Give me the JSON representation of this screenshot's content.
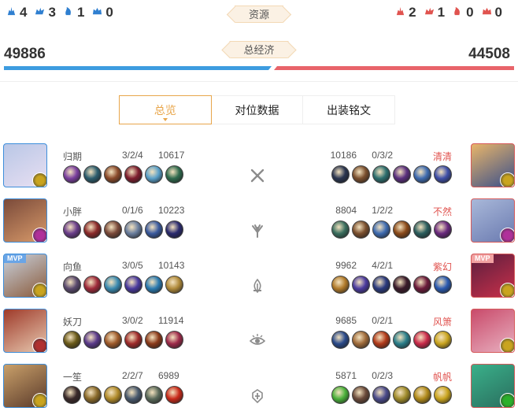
{
  "resources": {
    "label": "资源",
    "blue": [
      {
        "icon": "turret-icon",
        "value": "4"
      },
      {
        "icon": "dragon-icon",
        "value": "3"
      },
      {
        "icon": "tyrant-icon",
        "value": "1"
      },
      {
        "icon": "overlord-icon",
        "value": "0"
      }
    ],
    "red": [
      {
        "icon": "turret-icon",
        "value": "2"
      },
      {
        "icon": "dragon-icon",
        "value": "1"
      },
      {
        "icon": "tyrant-icon",
        "value": "0"
      },
      {
        "icon": "overlord-icon",
        "value": "0"
      }
    ],
    "colors": {
      "blue": "#2f7fd0",
      "red": "#e0534f"
    }
  },
  "economy": {
    "label": "总经济",
    "blue_total": "49886",
    "red_total": "44508",
    "blue_share": 0.528,
    "colors": {
      "blue": "#3d9ce0",
      "red": "#e8646a"
    }
  },
  "tabs": [
    {
      "label": "总览",
      "active": true
    },
    {
      "label": "对位数据",
      "active": false
    },
    {
      "label": "出装铭文",
      "active": false
    }
  ],
  "matchups": [
    {
      "objective_icon": "crossed-swords-icon",
      "blue": {
        "name": "归期",
        "kda": "3/2/4",
        "gold": "10617",
        "mvp": false,
        "portrait_colors": [
          "#b9c7e6",
          "#e8dff2"
        ],
        "spell_color": "#c9a41f",
        "items": [
          "#7a3f9e",
          "#2c5d6e",
          "#8a4a2a",
          "#7e1e2e",
          "#5aa0c9",
          "#2f6b4e"
        ]
      },
      "red": {
        "name": "清清",
        "kda": "0/3/2",
        "gold": "10186",
        "mvp": false,
        "portrait_colors": [
          "#e8b56a",
          "#3a4f8a"
        ],
        "spell_color": "#c9a41f",
        "items": [
          "#2a3550",
          "#7a4f2e",
          "#2c6e6e",
          "#5a2f7e",
          "#3e6bb0",
          "#3f4fa8"
        ]
      }
    },
    {
      "objective_icon": "jungle-icon",
      "blue": {
        "name": "小胖",
        "kda": "0/1/6",
        "gold": "10223",
        "mvp": false,
        "portrait_colors": [
          "#7a4a3a",
          "#d89a6a"
        ],
        "spell_color": "#b0309a",
        "items": [
          "#6a3e8a",
          "#8a2a2a",
          "#7a4a3a",
          "#6a7e9e",
          "#3a5a9e",
          "#2a2a6e"
        ]
      },
      "red": {
        "name": "不然",
        "kda": "1/2/2",
        "gold": "8804",
        "mvp": false,
        "portrait_colors": [
          "#a9b8d9",
          "#6a7ab0"
        ],
        "spell_color": "#b0309a",
        "items": [
          "#3a6e5e",
          "#7a4f2e",
          "#3e6bb0",
          "#8a4a1a",
          "#2c5e5e",
          "#6a2a7e"
        ]
      }
    },
    {
      "objective_icon": "mid-lane-icon",
      "blue": {
        "name": "向鱼",
        "kda": "3/0/5",
        "gold": "10143",
        "mvp": true,
        "portrait_colors": [
          "#c9d2de",
          "#8a5a3a"
        ],
        "spell_color": "#c9a41f",
        "items": [
          "#5a4a6e",
          "#9e2a3a",
          "#3a8ab0",
          "#4a3a9e",
          "#2a7ab0",
          "#b08a3a"
        ]
      },
      "red": {
        "name": "紫幻",
        "kda": "4/2/1",
        "gold": "9962",
        "mvp": true,
        "portrait_colors": [
          "#5a1e3e",
          "#c9304a"
        ],
        "spell_color": "#c9a41f",
        "items": [
          "#b07a2a",
          "#4a3a9e",
          "#2a3a7e",
          "#3a1a2a",
          "#6a1a3a",
          "#2a5ab0"
        ]
      }
    },
    {
      "objective_icon": "eye-icon",
      "blue": {
        "name": "妖刀",
        "kda": "3/0/2",
        "gold": "11914",
        "mvp": false,
        "portrait_colors": [
          "#9e3a2a",
          "#e8c9b0"
        ],
        "spell_color": "#b03030",
        "items": [
          "#6a5a1a",
          "#5a3a8a",
          "#9e5a2a",
          "#9e2a2a",
          "#8a3a1a",
          "#9e2a4a"
        ]
      },
      "red": {
        "name": "风箫",
        "kda": "0/2/1",
        "gold": "9685",
        "mvp": false,
        "portrait_colors": [
          "#c94a6a",
          "#e8b0c0"
        ],
        "spell_color": "#c9a41f",
        "items": [
          "#2a4a8a",
          "#9e6a3a",
          "#b03a1a",
          "#2a7e8a",
          "#c92a4a",
          "#c9a41f"
        ]
      }
    },
    {
      "objective_icon": "support-icon",
      "blue": {
        "name": "一笙",
        "kda": "2/2/7",
        "gold": "6989",
        "mvp": false,
        "portrait_colors": [
          "#c9a06a",
          "#5a3a2a"
        ],
        "spell_color": "#c9a41f",
        "items": [
          "#3a2a2a",
          "#8a6a2a",
          "#b08a2a",
          "#4a5a6e",
          "#5a6a5a",
          "#c92a1a"
        ]
      },
      "red": {
        "name": "帆帆",
        "kda": "0/2/3",
        "gold": "5871",
        "mvp": false,
        "portrait_colors": [
          "#3ab08a",
          "#2a6e5e"
        ],
        "spell_color": "#2ab02a",
        "items": [
          "#4ab03a",
          "#6a4a3a",
          "#4a4a8a",
          "#9e8a2a",
          "#b08a1a",
          "#c9a41f"
        ]
      }
    }
  ]
}
